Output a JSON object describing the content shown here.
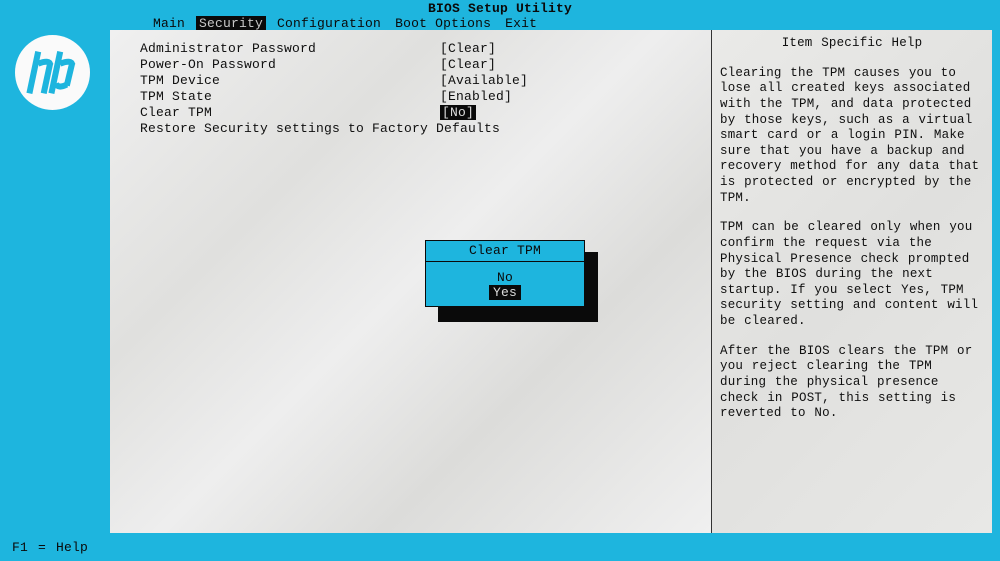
{
  "title": "BIOS Setup Utility",
  "menu": {
    "items": [
      "Main",
      "Security",
      "Configuration",
      "Boot Options",
      "Exit"
    ],
    "active_index": 1
  },
  "settings": [
    {
      "label": "Administrator Password",
      "value": "[Clear]"
    },
    {
      "label": "Power-On Password",
      "value": "[Clear]"
    },
    {
      "label": "TPM Device",
      "value": "[Available]"
    },
    {
      "label": "TPM State",
      "value": "[Enabled]"
    },
    {
      "label": "Clear TPM",
      "value": "[No]",
      "selected": true
    },
    {
      "label": "Restore Security settings to Factory Defaults",
      "value": ""
    }
  ],
  "dialog": {
    "title": "Clear TPM",
    "options": [
      "No",
      "Yes"
    ],
    "highlight_index": 1
  },
  "help": {
    "title": "Item Specific Help",
    "paragraphs": [
      "Clearing the TPM causes you to lose all created keys associated with the TPM, and data protected by those keys, such as a virtual smart card or a login PIN. Make sure that you have a backup and recovery method for any data that is protected or encrypted by the TPM.",
      "TPM can be cleared only when you confirm the request via the Physical Presence check prompted by the BIOS during the next startup. If you select Yes, TPM security setting and content will be cleared.",
      "After the BIOS clears the TPM or you reject clearing the TPM during the physical presence check in POST, this setting is reverted to No."
    ]
  },
  "footer": "F1 = Help",
  "logo_name": "hp"
}
